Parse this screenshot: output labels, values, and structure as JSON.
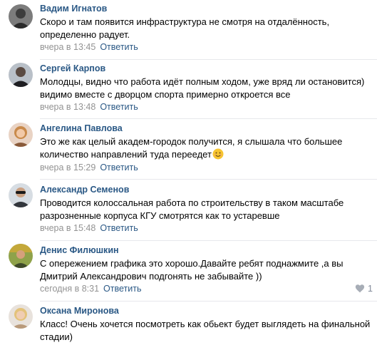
{
  "comments": [
    {
      "author": "Вадим Игнатов",
      "text": "Скоро и там появится инфраструктура не смотря на отдалённость, определенно радует.",
      "time": "вчера в 13:45",
      "reply_label": "Ответить"
    },
    {
      "author": "Сергей Карпов",
      "text": "Молодцы, видно что работа идёт полным ходом, уже вряд ли остановится) видимо вместе с дворцом спорта примерно откроется все",
      "time": "вчера в 13:48",
      "reply_label": "Ответить"
    },
    {
      "author": "Ангелина Павлова",
      "text": "Это же как целый академ-городок получится, я слышала что большее количество направлений туда переедет",
      "emoji": "smiling-face-icon",
      "time": "вчера в 15:29",
      "reply_label": "Ответить"
    },
    {
      "author": "Александр Семенов",
      "text": "Проводится колоссальная работа по строительству в таком масштабе разрозненные корпуса КГУ смотрятся как то устаревше",
      "time": "вчера в 15:48",
      "reply_label": "Ответить"
    },
    {
      "author": "Денис Филюшкин",
      "text": "С опережением графика это хорошо.Давайте ребят поднажмите ,а вы Дмитрий Александрович подгонять не забывайте ))",
      "time": "сегодня в 8:31",
      "reply_label": "Ответить",
      "likes": "1"
    },
    {
      "author": "Оксана Миронова",
      "text": "Класс! Очень хочется посмотреть как обьект будет выглядеть на финальной стадии)"
    }
  ],
  "colors": {
    "author": "#2a5885",
    "meta": "#939393",
    "divider": "#e7e8ec",
    "like": "#828a99"
  }
}
